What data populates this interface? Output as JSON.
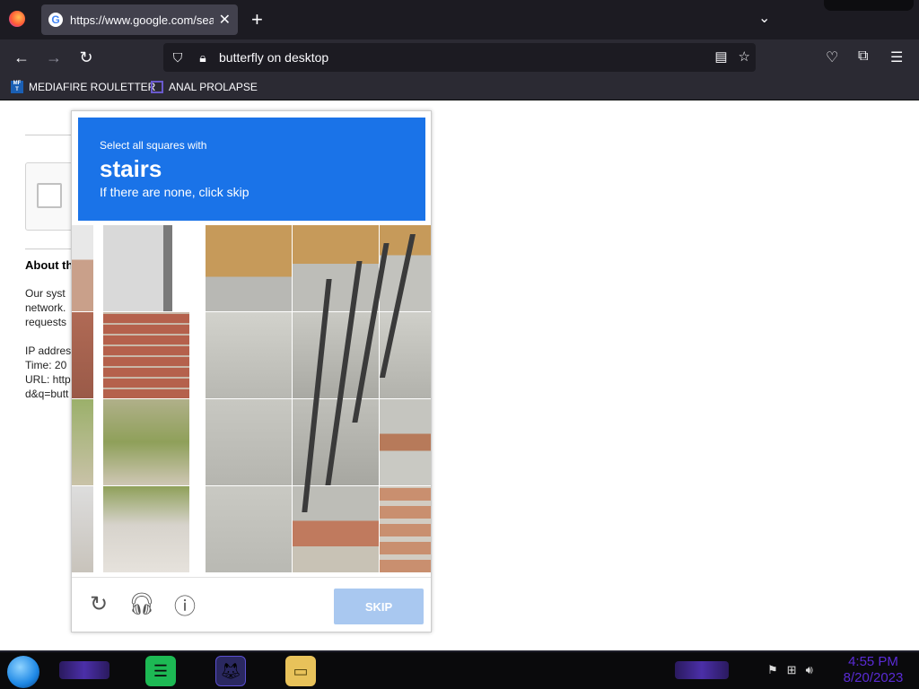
{
  "browser": {
    "tab_title": "https://www.google.com/search?",
    "tab_close": "✕",
    "new_tab": "+",
    "url_text": "butterfly on desktop",
    "bookmarks": [
      {
        "label": "MEDIAFIRE ROULETTER"
      },
      {
        "label": "ANAL PROLAPSE"
      }
    ]
  },
  "page": {
    "about_title": "About th",
    "about_lines": [
      "Our syst",
      "network.",
      "requests"
    ],
    "info_lines": [
      "IP addres",
      "Time: 20",
      "URL: http",
      "d&q=butt"
    ]
  },
  "captcha": {
    "instruction": "Select all squares with",
    "target": "stairs",
    "hint": "If there are none, click skip",
    "skip_label": "SKIP",
    "accent_color": "#1a73e8"
  },
  "taskbar": {
    "time": "4:55 PM",
    "date": "8/20/2023"
  }
}
